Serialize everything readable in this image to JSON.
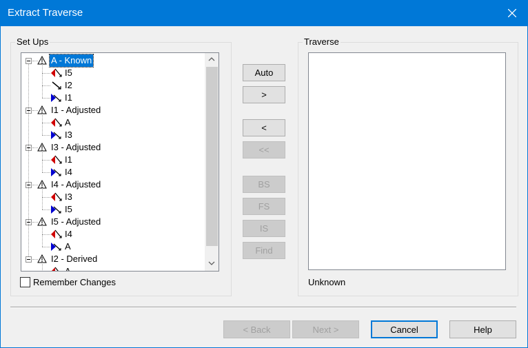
{
  "window": {
    "title": "Extract Traverse"
  },
  "setups": {
    "group_label": "Set Ups",
    "nodes": [
      {
        "label": "A - Known",
        "selected": true,
        "children": [
          {
            "label": "I5",
            "icon": "foresight-icon"
          },
          {
            "label": "I2",
            "icon": "sideshot-icon"
          },
          {
            "label": "I1",
            "icon": "backsight-icon"
          }
        ]
      },
      {
        "label": "I1 - Adjusted",
        "children": [
          {
            "label": "A",
            "icon": "foresight-icon"
          },
          {
            "label": "I3",
            "icon": "backsight-icon"
          }
        ]
      },
      {
        "label": "I3 - Adjusted",
        "children": [
          {
            "label": "I1",
            "icon": "foresight-icon"
          },
          {
            "label": "I4",
            "icon": "backsight-icon"
          }
        ]
      },
      {
        "label": "I4 - Adjusted",
        "children": [
          {
            "label": "I3",
            "icon": "foresight-icon"
          },
          {
            "label": "I5",
            "icon": "backsight-icon"
          }
        ]
      },
      {
        "label": "I5 - Adjusted",
        "children": [
          {
            "label": "I4",
            "icon": "foresight-icon"
          },
          {
            "label": "A",
            "icon": "backsight-icon"
          }
        ]
      },
      {
        "label": "I2 - Derived",
        "children": [
          {
            "label": "A",
            "icon": "foresight-icon"
          }
        ]
      }
    ],
    "remember_changes": {
      "label": "Remember Changes",
      "checked": false
    }
  },
  "middle_buttons": {
    "auto": "Auto",
    "add": ">",
    "remove": "<",
    "remove_all": "<<",
    "bs": "BS",
    "fs": "FS",
    "is": "IS",
    "find": "Find"
  },
  "traverse": {
    "group_label": "Traverse",
    "items": [],
    "status": "Unknown"
  },
  "footer": {
    "back": "< Back",
    "next": "Next >",
    "cancel": "Cancel",
    "help": "Help"
  },
  "colors": {
    "titlebar": "#0078d7",
    "selection": "#0078d7"
  }
}
